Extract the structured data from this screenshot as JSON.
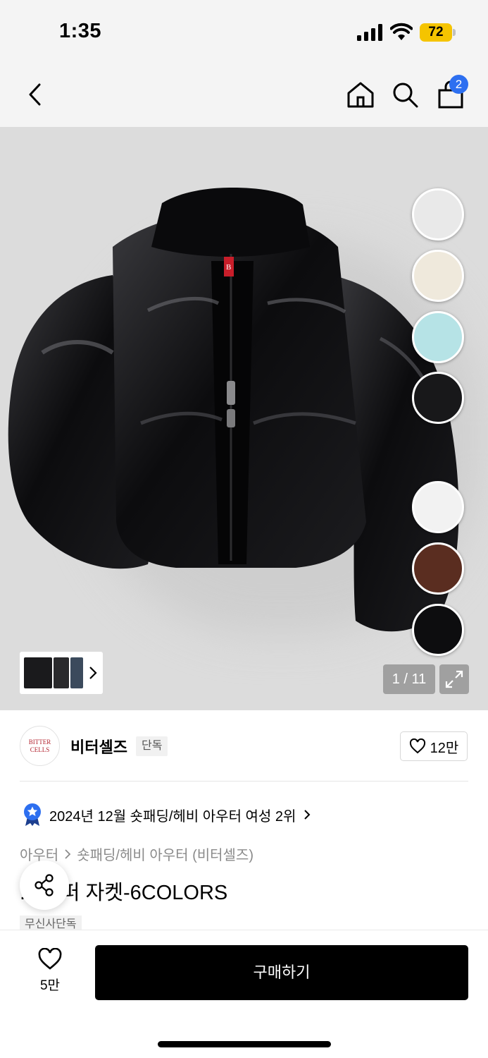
{
  "status": {
    "time": "1:35",
    "battery": "72",
    "icons": [
      "signal-icon",
      "wifi-icon",
      "battery-icon"
    ]
  },
  "nav": {
    "icons": [
      "back-icon",
      "home-icon",
      "search-icon",
      "shopping-bag-icon"
    ],
    "cart_count": "2"
  },
  "gallery": {
    "counter": "1 / 11",
    "swatches": [
      "#e9e9e9",
      "#efe9dc",
      "#b6e3e6",
      "#18181a",
      "#f2f2f2",
      "#5a2d20",
      "#0d0d0f"
    ],
    "thumb_icons": [
      "chevron-right-icon",
      "expand-icon"
    ],
    "label_mark": "B"
  },
  "brand": {
    "logo_line1": "BITTER",
    "logo_line2": "CELLS",
    "name": "비터셀즈",
    "tag": "단독",
    "likes": "12만"
  },
  "ranking": {
    "text": "2024년 12월 숏패딩/헤비 아우터 여성 2위"
  },
  "breadcrumb": {
    "level1": "아우터",
    "level2": "숏패딩/헤비 아우터 (비터셀즈)"
  },
  "product": {
    "title": "... 푸퍼 자켓-6COLORS",
    "exclusive": "무신사단독"
  },
  "bottom": {
    "wish_count": "5만",
    "buy_label": "구매하기"
  }
}
